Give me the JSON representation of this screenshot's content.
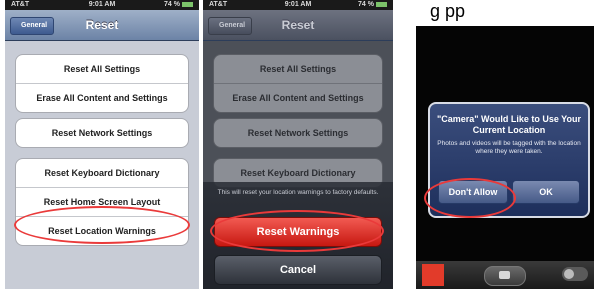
{
  "caption_fragment": "g        pp",
  "screen1": {
    "status": {
      "carrier": "AT&T",
      "time": "9:01 AM",
      "battery": "74 %"
    },
    "nav": {
      "back": "General",
      "title": "Reset"
    },
    "groups": [
      {
        "rows": [
          "Reset All Settings",
          "Erase All Content and Settings"
        ]
      },
      {
        "rows": [
          "Reset Network Settings"
        ]
      },
      {
        "rows": [
          "Reset Keyboard Dictionary",
          "Reset Home Screen Layout",
          "Reset Location Warnings"
        ]
      }
    ]
  },
  "screen2": {
    "status": {
      "carrier": "AT&T",
      "time": "9:01 AM",
      "battery": "74 %"
    },
    "nav": {
      "back": "General",
      "title": "Reset"
    },
    "groups": [
      {
        "rows": [
          "Reset All Settings",
          "Erase All Content and Settings"
        ]
      },
      {
        "rows": [
          "Reset Network Settings"
        ]
      },
      {
        "rows": [
          "Reset Keyboard Dictionary"
        ]
      }
    ],
    "sheet": {
      "message": "This will reset your location warnings to factory defaults.",
      "confirm": "Reset Warnings",
      "cancel": "Cancel"
    }
  },
  "screen3": {
    "alert": {
      "title": "\"Camera\" Would Like to Use Your Current Location",
      "message": "Photos and videos will be tagged with the location where they were taken.",
      "deny": "Don't Allow",
      "allow": "OK"
    }
  },
  "colors": {
    "highlight_circle": "#ea3a3a",
    "destructive": "#d9241c"
  }
}
